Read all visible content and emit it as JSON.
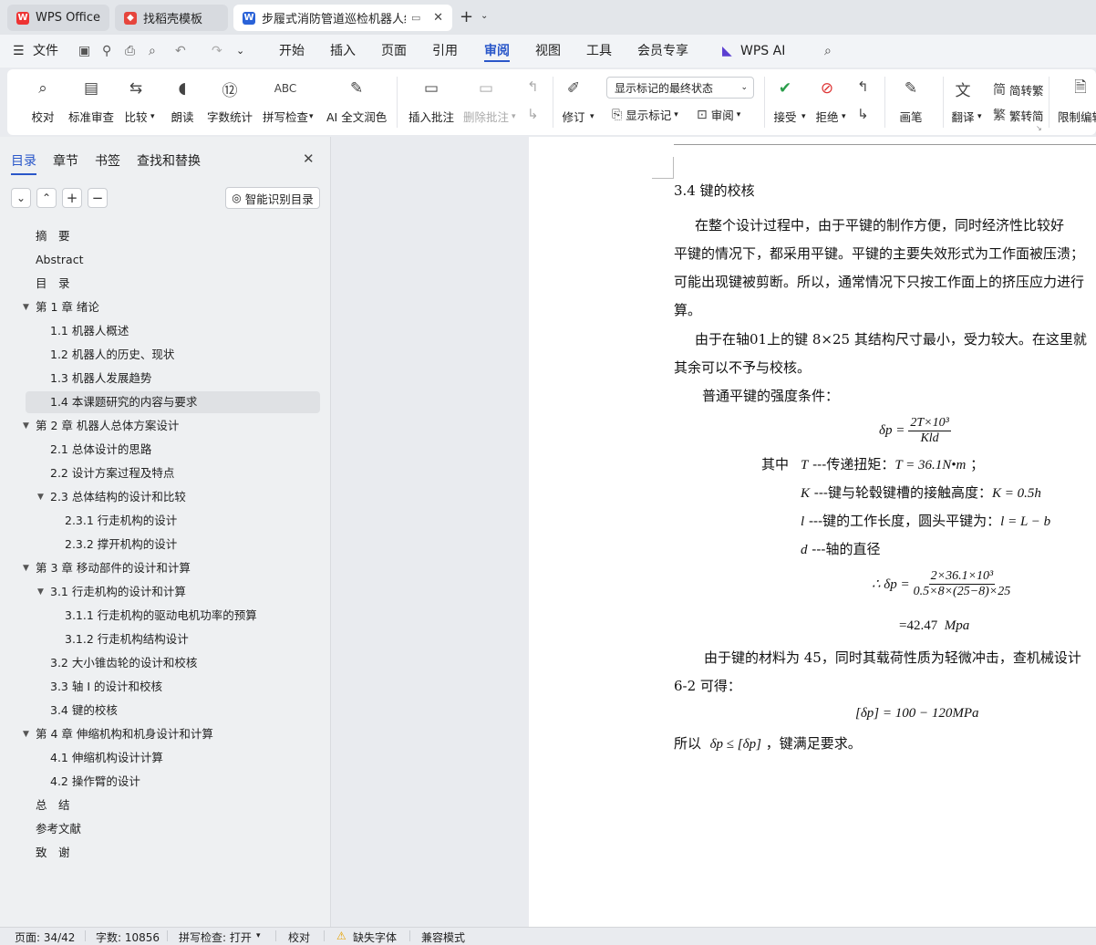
{
  "tabs": [
    {
      "label": "WPS Office",
      "icon": "wps-logo-icon"
    },
    {
      "label": "找稻壳模板",
      "icon": "docer-logo-icon"
    },
    {
      "label": "步履式消防管道巡检机器人结",
      "icon": "word-doc-icon"
    }
  ],
  "menu": {
    "file": "文件",
    "items": [
      "开始",
      "插入",
      "页面",
      "引用",
      "审阅",
      "视图",
      "工具",
      "会员专享"
    ],
    "active": "审阅",
    "ai": "WPS AI"
  },
  "ribbon": {
    "buttons": [
      "校对",
      "标准审查",
      "比较",
      "朗读",
      "字数统计",
      "拼写检查",
      "AI 全文润色",
      "插入批注",
      "删除批注",
      "修订",
      "接受",
      "拒绝",
      "画笔",
      "翻译",
      "限制编辑"
    ],
    "markup_state": "显示标记的最终状态",
    "show_markup": "显示标记",
    "review_pane": "审阅",
    "to_traditional": "简转繁",
    "to_simplified": "繁转简"
  },
  "sidebar": {
    "tabs": [
      "目录",
      "章节",
      "书签",
      "查找和替换"
    ],
    "smart_toc": "智能识别目录",
    "toc": [
      {
        "label": "摘　要",
        "level": 0
      },
      {
        "label": "Abstract",
        "level": 0
      },
      {
        "label": "目　录",
        "level": 0
      },
      {
        "label": "第 1 章  绪论",
        "level": 0,
        "expanded": true
      },
      {
        "label": "1.1  机器人概述",
        "level": 1
      },
      {
        "label": "1.2  机器人的历史、现状",
        "level": 1
      },
      {
        "label": "1.3 机器人发展趋势",
        "level": 1
      },
      {
        "label": "1.4  本课题研究的内容与要求",
        "level": 1,
        "selected": true
      },
      {
        "label": "第 2 章  机器人总体方案设计",
        "level": 0,
        "expanded": true
      },
      {
        "label": "2.1 总体设计的思路",
        "level": 1
      },
      {
        "label": "2.2  设计方案过程及特点",
        "level": 1
      },
      {
        "label": "2.3  总体结构的设计和比较",
        "level": 1,
        "expanded": true
      },
      {
        "label": "2.3.1  行走机构的设计",
        "level": 2
      },
      {
        "label": "2.3.2  撑开机构的设计",
        "level": 2
      },
      {
        "label": "第 3 章  移动部件的设计和计算",
        "level": 0,
        "expanded": true
      },
      {
        "label": "3.1  行走机构的设计和计算",
        "level": 1,
        "expanded": true
      },
      {
        "label": "3.1.1  行走机构的驱动电机功率的预算",
        "level": 2
      },
      {
        "label": "3.1.2  行走机构结构设计",
        "level": 2
      },
      {
        "label": "3.2 大小锥齿轮的设计和校核",
        "level": 1
      },
      {
        "label": "3.3  轴 I 的设计和校核",
        "level": 1
      },
      {
        "label": "3.4  键的校核",
        "level": 1
      },
      {
        "label": "第 4 章  伸缩机构和机身设计和计算",
        "level": 0,
        "expanded": true
      },
      {
        "label": "4.1  伸缩机构设计计算",
        "level": 1
      },
      {
        "label": "4.2  操作臂的设计",
        "level": 1
      },
      {
        "label": "总　结",
        "level": 0
      },
      {
        "label": "参考文献",
        "level": 0
      },
      {
        "label": "致　谢",
        "level": 0
      }
    ]
  },
  "document": {
    "heading": "3.4  键的校核",
    "p1": [
      "在整个设计过程中，由于平键的制作方便，同时经济性比较好",
      "平键的情况下，都采用平键。平键的主要失效形式为工作面被压溃；",
      "可能出现键被剪断。所以，通常情况下只按工作面上的挤压应力进行",
      "算。"
    ],
    "p2": [
      "由于在轴01上的键  8×25  其结构尺寸最小，受力较大。在这里就",
      "其余可以不予与校核。"
    ],
    "p3": "普通平键的强度条件：",
    "f1_lhs": "δp =",
    "f1_num": "2T×10³",
    "f1_den": "Kld",
    "where_prefix": "其中",
    "defs": [
      {
        "sym": "T",
        "text": " ---传递扭矩：",
        "eq": "T = 36.1N•m",
        "tail": "  ；"
      },
      {
        "sym": "K",
        "text": " ---键与轮毂键槽的接触高度：",
        "eq": "K = 0.5h",
        "tail": ""
      },
      {
        "sym": "l",
        "text": " ---键的工作长度，圆头平键为：",
        "eq": "l = L − b",
        "tail": ""
      },
      {
        "sym": "d",
        "text": " ---轴的直径",
        "eq": "",
        "tail": ""
      }
    ],
    "f2_lhs": "∴ δp =",
    "f2_num": "2×36.1×10³",
    "f2_den": "0.5×8×(25−8)×25",
    "f2_result": "=42.47",
    "f2_unit": "Mpa",
    "p4": [
      "由于键的材料为 45，同时其载荷性质为轻微冲击，查机械设计",
      "6-2 可得："
    ],
    "f3": "[δp] = 100 − 120MPa",
    "conclusion_prefix": "所以",
    "conclusion_formula": "δp ≤ [δp]",
    "conclusion_suffix": "，键满足要求。"
  },
  "status": {
    "page": "页面: 34/42",
    "words": "字数: 10856",
    "spell": "拼写检查: 打开",
    "proof": "校对",
    "missing_font": "缺失字体",
    "compat": "兼容模式"
  }
}
